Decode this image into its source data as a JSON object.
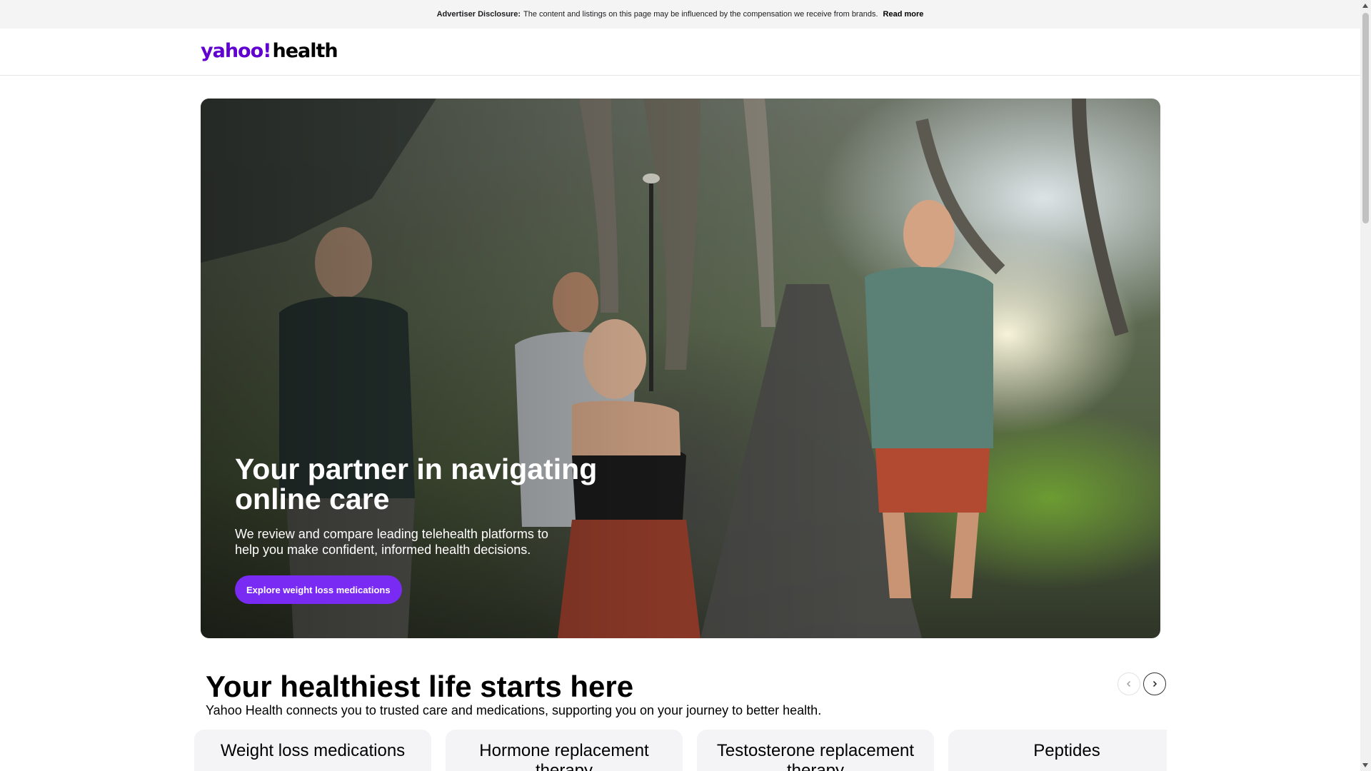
{
  "disclosure": {
    "label": "Advertiser Disclosure:",
    "text": "The content and listings on this page may be influenced by the compensation we receive from brands.",
    "link": "Read more"
  },
  "header": {
    "logo_brand": "yahoo!",
    "logo_section": "health"
  },
  "hero": {
    "title": "Your partner in navigating online care",
    "subtitle": "We review and compare leading telehealth platforms to help you make confident, informed health decisions.",
    "cta": "Explore weight loss medications"
  },
  "section": {
    "title": "Your healthiest life starts here",
    "subtitle": "Yahoo Health connects you to trusted care and medications, supporting you on your journey to better health.",
    "prev_icon": "chevron-left-icon",
    "next_icon": "chevron-right-icon"
  },
  "cards": [
    {
      "label": "Weight loss medications"
    },
    {
      "label": "Hormone replacement therapy"
    },
    {
      "label": "Testosterone replacement therapy"
    },
    {
      "label": "Peptides"
    }
  ],
  "colors": {
    "brand_purple": "#6001d2",
    "cta_purple": "#7a2bf3"
  }
}
